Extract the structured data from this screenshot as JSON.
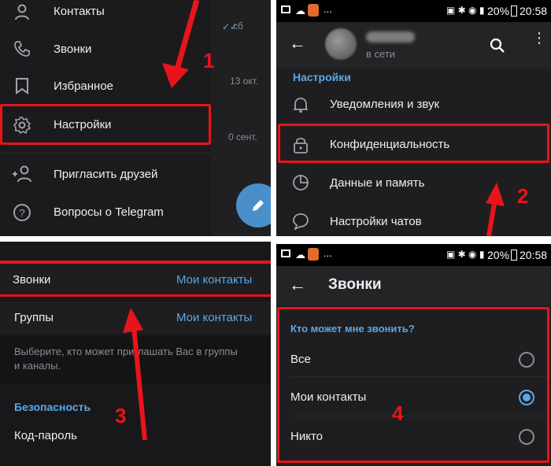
{
  "panel1": {
    "items": [
      {
        "label": "Контакты",
        "icon": "person-icon"
      },
      {
        "label": "Звонки",
        "icon": "phone-icon"
      },
      {
        "label": "Избранное",
        "icon": "bookmark-icon"
      },
      {
        "label": "Настройки",
        "icon": "gear-icon"
      },
      {
        "label": "Пригласить друзей",
        "icon": "add-person-icon"
      },
      {
        "label": "Вопросы о Telegram",
        "icon": "help-icon"
      }
    ],
    "chat_dates": [
      "сб",
      "13 окт.",
      "0 сент."
    ],
    "step": "1"
  },
  "panel2": {
    "status": {
      "time": "20:58",
      "battery": "20%"
    },
    "profile_status": "в сети",
    "section_title": "Настройки",
    "items": [
      {
        "label": "Уведомления и звук",
        "icon": "bell-icon"
      },
      {
        "label": "Конфиденциальность",
        "icon": "lock-icon"
      },
      {
        "label": "Данные и память",
        "icon": "clock-icon"
      },
      {
        "label": "Настройки чатов",
        "icon": "chat-bubble-icon"
      }
    ],
    "step": "2"
  },
  "panel3": {
    "rows": [
      {
        "label": "Звонки",
        "value": "Мои контакты"
      },
      {
        "label": "Группы",
        "value": "Мои контакты"
      }
    ],
    "hint": "Выберите, кто может приглашать Вас в группы и каналы.",
    "hint_line1": "Выберите, кто может приглашать Вас в группы",
    "hint_line2": "и каналы.",
    "section_title": "Безопасность",
    "passcode": "Код-пароль",
    "step": "3"
  },
  "panel4": {
    "status": {
      "time": "20:58",
      "battery": "20%"
    },
    "title": "Звонки",
    "question": "Кто может мне звонить?",
    "options": [
      {
        "label": "Все",
        "selected": false
      },
      {
        "label": "Мои контакты",
        "selected": true
      },
      {
        "label": "Никто",
        "selected": false
      }
    ],
    "step": "4"
  },
  "colors": {
    "accent": "#5aa7e6",
    "highlight": "#e8141b",
    "background": "#1e1e20"
  }
}
